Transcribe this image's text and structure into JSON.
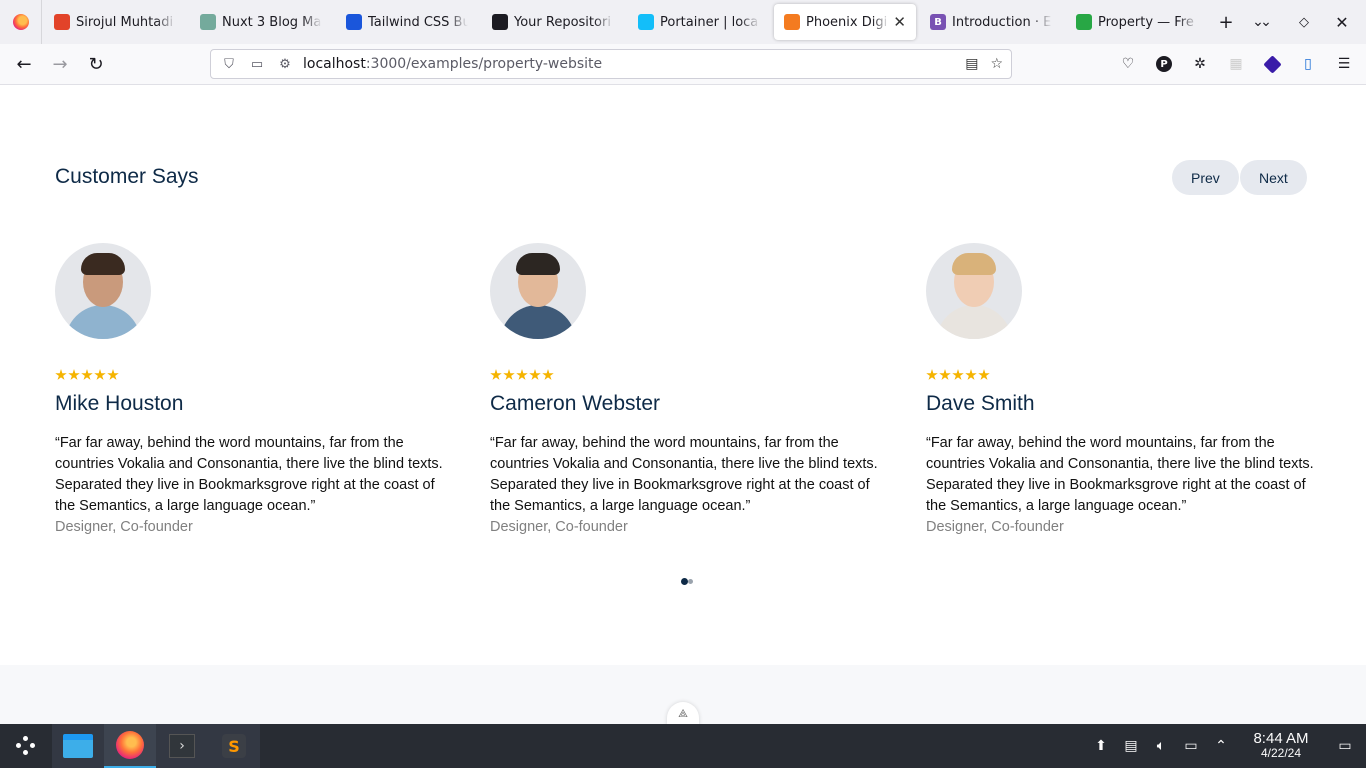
{
  "browser": {
    "tabs": [
      {
        "label": "Sirojul Muhtadi",
        "color": "#e24329",
        "glyph": ""
      },
      {
        "label": "Nuxt 3 Blog Ma",
        "color": "#74aa9c",
        "glyph": ""
      },
      {
        "label": "Tailwind CSS Bu",
        "color": "#1a56db",
        "glyph": ""
      },
      {
        "label": "Your Repositori",
        "color": "#1c1b22",
        "glyph": ""
      },
      {
        "label": "Portainer | loca",
        "color": "#13bef9",
        "glyph": ""
      },
      {
        "label": "Phoenix Digi",
        "color": "#f47b20",
        "glyph": ""
      },
      {
        "label": "Introduction · E",
        "color": "#7952b3",
        "glyph": "B"
      },
      {
        "label": "Property — Fre",
        "color": "#28a745",
        "glyph": ""
      }
    ],
    "active_tab": 5,
    "new_tab_glyph": "+",
    "tab_list_glyph": "⌄",
    "url": {
      "host": "localhost",
      "path": ":3000/examples/property-website"
    }
  },
  "section": {
    "title": "Customer Says",
    "prev_label": "Prev",
    "next_label": "Next"
  },
  "testimonials": [
    {
      "name": "Mike Houston",
      "quote": "“Far far away, behind the word mountains, far from the countries Vokalia and Consonantia, there live the blind texts. Separated they live in Bookmarksgrove right at the coast of the Semantics, a large language ocean.”",
      "role": "Designer, Co-founder",
      "rating": 5,
      "skin": "#c99a7c",
      "hair": "#3a2a20",
      "shirt": "#8fb3cf"
    },
    {
      "name": "Cameron Webster",
      "quote": "“Far far away, behind the word mountains, far from the countries Vokalia and Consonantia, there live the blind texts. Separated they live in Bookmarksgrove right at the coast of the Semantics, a large language ocean.”",
      "role": "Designer, Co-founder",
      "rating": 5,
      "skin": "#e2b899",
      "hair": "#2c2622",
      "shirt": "#3f5a78"
    },
    {
      "name": "Dave Smith",
      "quote": "“Far far away, behind the word mountains, far from the countries Vokalia and Consonantia, there live the blind texts. Separated they live in Bookmarksgrove right at the coast of the Semantics, a large language ocean.”",
      "role": "Designer, Co-founder",
      "rating": 5,
      "skin": "#f0cdb4",
      "hair": "#d9b27a",
      "shirt": "#e8e4df"
    }
  ],
  "carousel": {
    "active_dot": 0,
    "dot_count": 2
  },
  "colors": {
    "accent": "#0e2a47",
    "star": "#f5b400",
    "muted": "#808080"
  },
  "taskbar": {
    "time": "8:44 AM",
    "date": "4/22/24"
  }
}
